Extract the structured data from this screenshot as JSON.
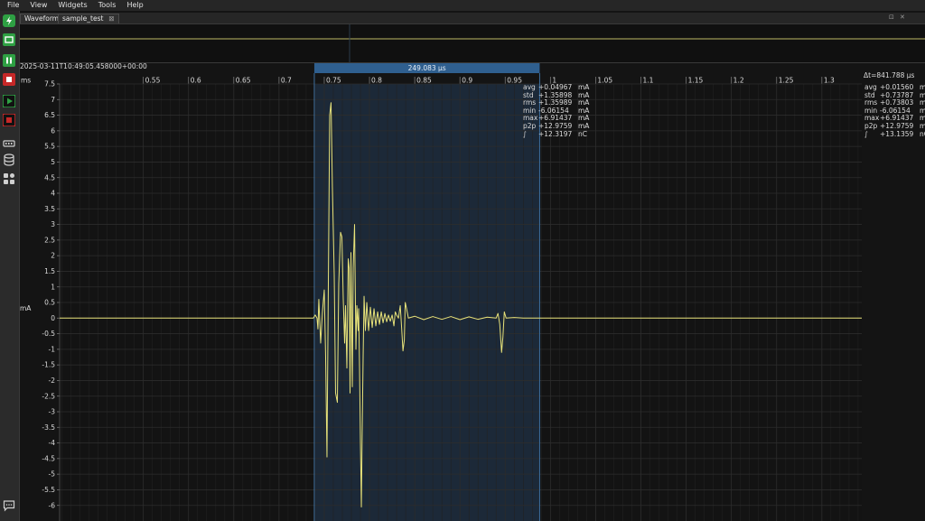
{
  "menu": [
    "File",
    "View",
    "Widgets",
    "Tools",
    "Help"
  ],
  "tabs": [
    {
      "label": "Waveform"
    },
    {
      "label": "sample_test",
      "close": "⊠"
    }
  ],
  "window_controls": {
    "restore": "⊡",
    "close": "✕"
  },
  "timestamp": "2025-03-11T10:49:05.458000+00:00",
  "selection": {
    "label": "249.083 µs",
    "start": 0.739,
    "end": 0.9881
  },
  "delta_t_label": "Δt=841.788 µs",
  "axis": {
    "x_unit": "ms",
    "y_unit": "mA",
    "x_range": [
      0.4575,
      1.3441
    ],
    "y_range": [
      -6.5,
      7.5
    ],
    "x_ticks": [
      "0.55",
      "0.6",
      "0.65",
      "0.7",
      "0.75",
      "0.8",
      "0.85",
      "0.9",
      "0.95",
      "1",
      "1.05",
      "1.1",
      "1.15",
      "1.2",
      "1.25",
      "1.3"
    ],
    "y_ticks": [
      "7.5",
      "7",
      "6.5",
      "6",
      "5.5",
      "5",
      "4.5",
      "4",
      "3.5",
      "3",
      "2.5",
      "2",
      "1.5",
      "1",
      "0.5",
      "0",
      "-0.5",
      "-1",
      "-1.5",
      "-2",
      "-2.5",
      "-3",
      "-3.5",
      "-4",
      "-4.5",
      "-5",
      "-5.5",
      "-6"
    ]
  },
  "stats_selection": [
    {
      "k": "avg",
      "v": "+0.04967",
      "u": "mA"
    },
    {
      "k": "std",
      "v": "+1.35898",
      "u": "mA"
    },
    {
      "k": "rms",
      "v": "+1.35989",
      "u": "mA"
    },
    {
      "k": "min",
      "v": "-6.06154",
      "u": "mA"
    },
    {
      "k": "max",
      "v": "+6.91437",
      "u": "mA"
    },
    {
      "k": "p2p",
      "v": "+12.9759",
      "u": "mA"
    },
    {
      "k": "∫",
      "v": "+12.3197",
      "u": "nC"
    }
  ],
  "stats_full": [
    {
      "k": "avg",
      "v": "+0.01560",
      "u": "mA"
    },
    {
      "k": "std",
      "v": "+0.73787",
      "u": "mA"
    },
    {
      "k": "rms",
      "v": "+0.73803",
      "u": "mA"
    },
    {
      "k": "min",
      "v": "-6.06154",
      "u": "mA"
    },
    {
      "k": "max",
      "v": "+6.91437",
      "u": "mA"
    },
    {
      "k": "p2p",
      "v": "+12.9759",
      "u": "mA"
    },
    {
      "k": "∫",
      "v": "+13.1359",
      "u": "nC"
    }
  ],
  "toolbar": [
    {
      "name": "power-icon",
      "color": "#2ea043"
    },
    {
      "name": "device-icon",
      "color": "#2ea043"
    },
    {
      "name": "pause-icon",
      "color": "#2ea043"
    },
    {
      "name": "stop-icon",
      "color": "#c62828"
    },
    {
      "name": "play-icon",
      "color": "#2ea043"
    },
    {
      "name": "record-icon",
      "color": "#c62828"
    },
    {
      "name": "memory-icon",
      "color": "#cfcfcf"
    },
    {
      "name": "database-icon",
      "color": "#cfcfcf"
    },
    {
      "name": "widgets-icon",
      "color": "#cfcfcf"
    },
    {
      "name": "chat-icon",
      "color": "#cfcfcf"
    }
  ],
  "colors": {
    "trace": "#e8e37a",
    "selection_fill": "#1e2c3d",
    "selection_header": "#2f5f8f",
    "grid": "#2c2c2c"
  },
  "waveform": [
    [
      0.4575,
      0
    ],
    [
      0.738,
      0
    ],
    [
      0.74,
      0.1
    ],
    [
      0.742,
      0
    ],
    [
      0.743,
      -0.35
    ],
    [
      0.744,
      0.6
    ],
    [
      0.746,
      -0.8
    ],
    [
      0.748,
      0.2
    ],
    [
      0.75,
      0.9
    ],
    [
      0.7515,
      -1.2
    ],
    [
      0.753,
      -4.45
    ],
    [
      0.756,
      6.5
    ],
    [
      0.7575,
      6.9
    ],
    [
      0.759,
      4.2
    ],
    [
      0.761,
      1.4
    ],
    [
      0.7625,
      -2.4
    ],
    [
      0.7645,
      -2.7
    ],
    [
      0.766,
      1.1
    ],
    [
      0.768,
      2.75
    ],
    [
      0.7695,
      2.6
    ],
    [
      0.771,
      0.6
    ],
    [
      0.7725,
      -0.8
    ],
    [
      0.7735,
      0.4
    ],
    [
      0.775,
      -1.6
    ],
    [
      0.7765,
      1.9
    ],
    [
      0.7775,
      1.6
    ],
    [
      0.7785,
      -2.4
    ],
    [
      0.7795,
      2.1
    ],
    [
      0.781,
      -2.2
    ],
    [
      0.782,
      1.6
    ],
    [
      0.7835,
      3.0
    ],
    [
      0.785,
      -1.0
    ],
    [
      0.786,
      0.4
    ],
    [
      0.7875,
      -0.4
    ],
    [
      0.788,
      0.3
    ],
    [
      0.789,
      -1.6
    ],
    [
      0.79,
      -4.0
    ],
    [
      0.791,
      -6.05
    ],
    [
      0.792,
      -3.4
    ],
    [
      0.793,
      -1.2
    ],
    [
      0.794,
      0.7
    ],
    [
      0.7955,
      -0.4
    ],
    [
      0.797,
      0.5
    ],
    [
      0.799,
      -0.4
    ],
    [
      0.801,
      0.35
    ],
    [
      0.803,
      -0.3
    ],
    [
      0.805,
      0.3
    ],
    [
      0.807,
      -0.25
    ],
    [
      0.809,
      0.2
    ],
    [
      0.811,
      -0.2
    ],
    [
      0.813,
      0.2
    ],
    [
      0.815,
      -0.15
    ],
    [
      0.817,
      0.15
    ],
    [
      0.819,
      -0.12
    ],
    [
      0.821,
      0.1
    ],
    [
      0.823,
      -0.1
    ],
    [
      0.825,
      0.1
    ],
    [
      0.827,
      -0.25
    ],
    [
      0.8285,
      0.2
    ],
    [
      0.83,
      0.1
    ],
    [
      0.832,
      0.0
    ],
    [
      0.834,
      0.4
    ],
    [
      0.8355,
      -0.3
    ],
    [
      0.837,
      -1.05
    ],
    [
      0.8385,
      -0.7
    ],
    [
      0.8395,
      0.5
    ],
    [
      0.841,
      0.3
    ],
    [
      0.843,
      0
    ],
    [
      0.85,
      0.06
    ],
    [
      0.86,
      -0.05
    ],
    [
      0.87,
      0.05
    ],
    [
      0.88,
      -0.04
    ],
    [
      0.89,
      0.05
    ],
    [
      0.9,
      -0.05
    ],
    [
      0.91,
      0.04
    ],
    [
      0.92,
      -0.04
    ],
    [
      0.93,
      0.03
    ],
    [
      0.94,
      0
    ],
    [
      0.942,
      0.15
    ],
    [
      0.944,
      -0.2
    ],
    [
      0.946,
      -1.1
    ],
    [
      0.9475,
      -0.6
    ],
    [
      0.949,
      0.2
    ],
    [
      0.951,
      0
    ],
    [
      0.96,
      0.02
    ],
    [
      0.97,
      0
    ],
    [
      1.3441,
      0
    ]
  ]
}
